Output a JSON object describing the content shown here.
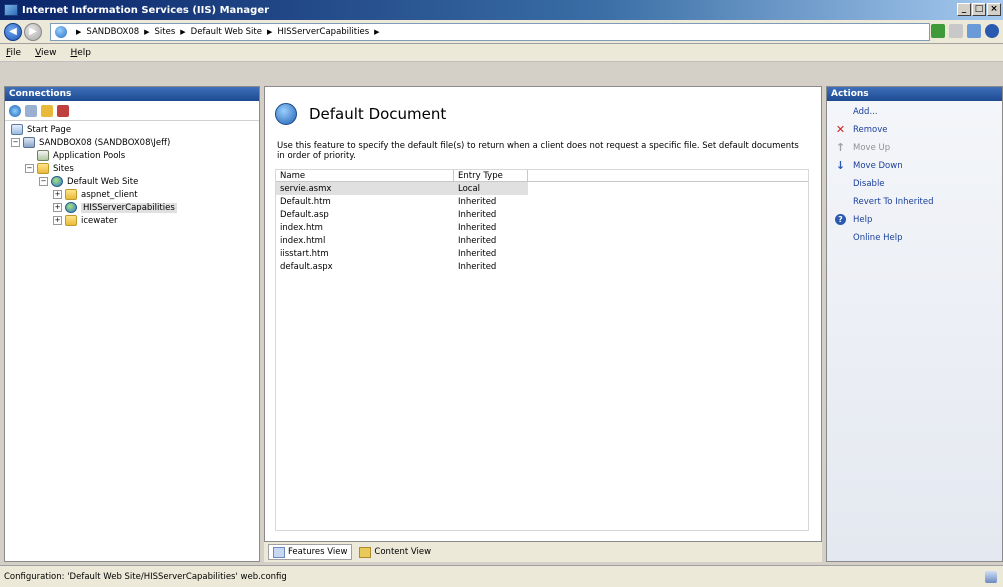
{
  "window": {
    "title": "Internet Information Services (IIS) Manager",
    "controls": {
      "minimize": "_",
      "maximize": "□",
      "close": "×"
    }
  },
  "address": {
    "crumbs": [
      "SANDBOX08",
      "Sites",
      "Default Web Site",
      "HISServerCapabilities"
    ]
  },
  "menu": {
    "file": "File",
    "view": "View",
    "help": "Help"
  },
  "connections": {
    "header": "Connections",
    "tree": {
      "start_page": "Start Page",
      "server": "SANDBOX08 (SANDBOX08\\Jeff)",
      "app_pools": "Application Pools",
      "sites": "Sites",
      "default_web_site": "Default Web Site",
      "children": [
        "aspnet_client",
        "HISServerCapabilities",
        "icewater"
      ]
    }
  },
  "main": {
    "title": "Default Document",
    "description": "Use this feature to specify the default file(s) to return when a client does not request a specific file. Set default documents in order of priority.",
    "columns": [
      "Name",
      "Entry Type"
    ],
    "rows": [
      {
        "name": "servie.asmx",
        "type": "Local"
      },
      {
        "name": "Default.htm",
        "type": "Inherited"
      },
      {
        "name": "Default.asp",
        "type": "Inherited"
      },
      {
        "name": "index.htm",
        "type": "Inherited"
      },
      {
        "name": "index.html",
        "type": "Inherited"
      },
      {
        "name": "iisstart.htm",
        "type": "Inherited"
      },
      {
        "name": "default.aspx",
        "type": "Inherited"
      }
    ]
  },
  "tabs": {
    "features": "Features View",
    "content": "Content View"
  },
  "actions": {
    "header": "Actions",
    "add": "Add...",
    "remove": "Remove",
    "move_up": "Move Up",
    "move_down": "Move Down",
    "disable": "Disable",
    "revert": "Revert To Inherited",
    "help": "Help",
    "online_help": "Online Help"
  },
  "status": {
    "text": "Configuration: 'Default Web Site/HISServerCapabilities' web.config"
  }
}
